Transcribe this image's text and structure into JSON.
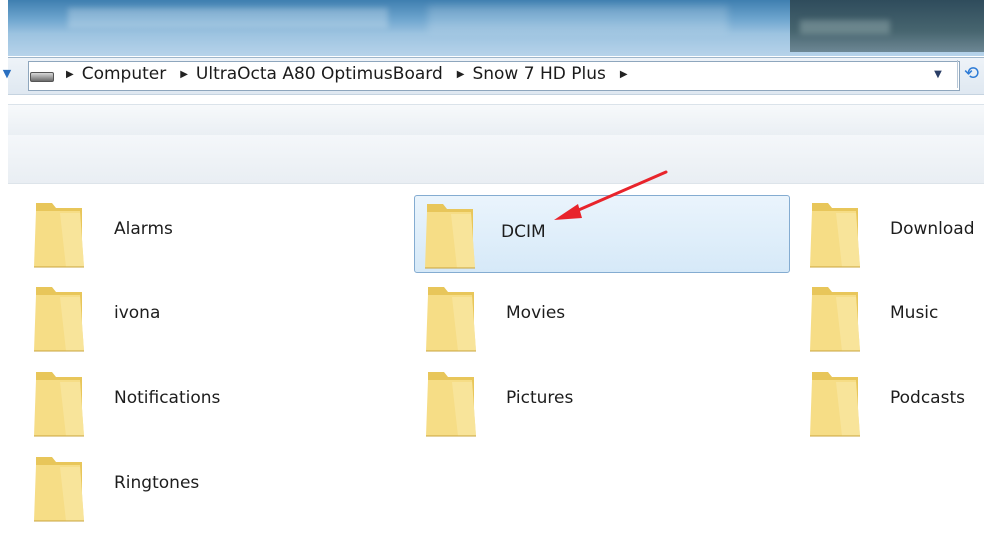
{
  "address_bar": {
    "breadcrumbs": [
      "Computer",
      "UltraOcta A80 OptimusBoard",
      "Snow 7 HD Plus"
    ]
  },
  "folders": [
    {
      "name": "Alarms"
    },
    {
      "name": "DCIM",
      "selected": true
    },
    {
      "name": "Download"
    },
    {
      "name": "ivona"
    },
    {
      "name": "Movies"
    },
    {
      "name": "Music"
    },
    {
      "name": "Notifications"
    },
    {
      "name": "Pictures"
    },
    {
      "name": "Podcasts"
    },
    {
      "name": "Ringtones"
    }
  ],
  "icons": {
    "folder": "folder-icon",
    "drive": "drive-icon",
    "refresh": "refresh-icon",
    "dropdown": "chevron-down-icon"
  },
  "colors": {
    "selection_fill": "#d6e9f8",
    "selection_border": "#84acd1",
    "annotation_arrow": "#e8242b",
    "folder_yellow": "#f3d97a"
  }
}
